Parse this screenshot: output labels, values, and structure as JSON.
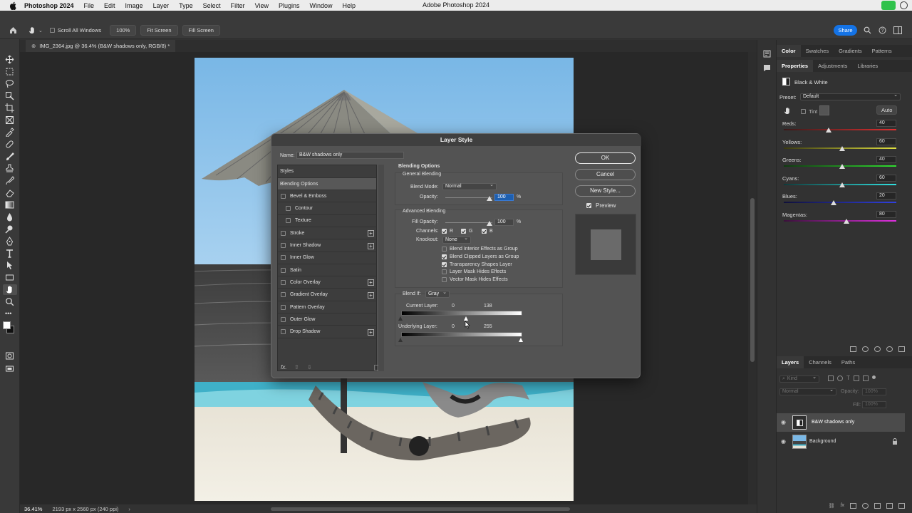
{
  "menubar": {
    "app": "Photoshop 2024",
    "items": [
      "File",
      "Edit",
      "Image",
      "Layer",
      "Type",
      "Select",
      "Filter",
      "View",
      "Plugins",
      "Window",
      "Help"
    ],
    "window_title": "Adobe Photoshop 2024"
  },
  "optionsbar": {
    "scroll_all_windows": "Scroll All Windows",
    "zoom": "100%",
    "fit_screen": "Fit Screen",
    "fill_screen": "Fill Screen",
    "share": "Share"
  },
  "document": {
    "tab": "IMG_2364.jpg @ 36.4% (B&W shadows only, RGB/8) *",
    "zoom_status": "36.41%",
    "size_status": "2193 px x 2560 px (240 ppi)"
  },
  "panels": {
    "top_tabs": [
      "Color",
      "Swatches",
      "Gradients",
      "Patterns"
    ],
    "prop_tabs": [
      "Properties",
      "Adjustments",
      "Libraries"
    ],
    "adjustment_name": "Black & White",
    "preset_label": "Preset:",
    "preset_value": "Default",
    "tint_label": "Tint",
    "auto_label": "Auto",
    "sliders": [
      {
        "label": "Reds:",
        "value": "40",
        "pos": 0.4
      },
      {
        "label": "Yellows:",
        "value": "60",
        "pos": 0.52
      },
      {
        "label": "Greens:",
        "value": "40",
        "pos": 0.52
      },
      {
        "label": "Cyans:",
        "value": "60",
        "pos": 0.52
      },
      {
        "label": "Blues:",
        "value": "20",
        "pos": 0.44
      },
      {
        "label": "Magentas:",
        "value": "80",
        "pos": 0.56
      }
    ],
    "layers_tabs": [
      "Layers",
      "Channels",
      "Paths"
    ],
    "kind_label": "Kind",
    "blend_mode": "Normal",
    "opacity_label": "Opacity:",
    "opacity_value": "100%",
    "fill_label": "Fill:",
    "fill_value": "100%",
    "layers": [
      {
        "name": "B&W shadows only"
      },
      {
        "name": "Background"
      }
    ]
  },
  "dialog": {
    "title": "Layer Style",
    "name_label": "Name:",
    "name_value": "B&W shadows only",
    "styles_header": "Styles",
    "styles": [
      {
        "label": "Blending Options",
        "checkbox": false,
        "plus": false,
        "indent": false,
        "selected": true
      },
      {
        "label": "Bevel & Emboss",
        "checkbox": true,
        "plus": false,
        "indent": false
      },
      {
        "label": "Contour",
        "checkbox": true,
        "plus": false,
        "indent": true
      },
      {
        "label": "Texture",
        "checkbox": true,
        "plus": false,
        "indent": true
      },
      {
        "label": "Stroke",
        "checkbox": true,
        "plus": true,
        "indent": false
      },
      {
        "label": "Inner Shadow",
        "checkbox": true,
        "plus": true,
        "indent": false
      },
      {
        "label": "Inner Glow",
        "checkbox": true,
        "plus": false,
        "indent": false
      },
      {
        "label": "Satin",
        "checkbox": true,
        "plus": false,
        "indent": false
      },
      {
        "label": "Color Overlay",
        "checkbox": true,
        "plus": true,
        "indent": false
      },
      {
        "label": "Gradient Overlay",
        "checkbox": true,
        "plus": true,
        "indent": false
      },
      {
        "label": "Pattern Overlay",
        "checkbox": true,
        "plus": false,
        "indent": false
      },
      {
        "label": "Outer Glow",
        "checkbox": true,
        "plus": false,
        "indent": false
      },
      {
        "label": "Drop Shadow",
        "checkbox": true,
        "plus": true,
        "indent": false
      }
    ],
    "fx_label": "fx.",
    "blending_options": "Blending Options",
    "general_blending": "General Blending",
    "blend_mode_label": "Blend Mode:",
    "blend_mode_value": "Normal",
    "opacity_label": "Opacity:",
    "opacity_value": "100",
    "percent": "%",
    "advanced_blending": "Advanced Blending",
    "fill_opacity_label": "Fill Opacity:",
    "fill_opacity_value": "100",
    "channels_label": "Channels:",
    "channels": [
      "R",
      "G",
      "B"
    ],
    "knockout_label": "Knockout:",
    "knockout_value": "None",
    "advanced_options": [
      {
        "label": "Blend Interior Effects as Group",
        "checked": false
      },
      {
        "label": "Blend Clipped Layers as Group",
        "checked": true
      },
      {
        "label": "Transparency Shapes Layer",
        "checked": true
      },
      {
        "label": "Layer Mask Hides Effects",
        "checked": false
      },
      {
        "label": "Vector Mask Hides Effects",
        "checked": false
      }
    ],
    "blend_if_label": "Blend If:",
    "blend_if_value": "Gray",
    "current_layer_label": "Current Layer:",
    "current_layer_low": "0",
    "current_layer_high": "138",
    "underlying_layer_label": "Underlying Layer:",
    "underlying_layer_low": "0",
    "underlying_layer_high": "255",
    "ok": "OK",
    "cancel": "Cancel",
    "new_style": "New Style...",
    "preview": "Preview"
  }
}
